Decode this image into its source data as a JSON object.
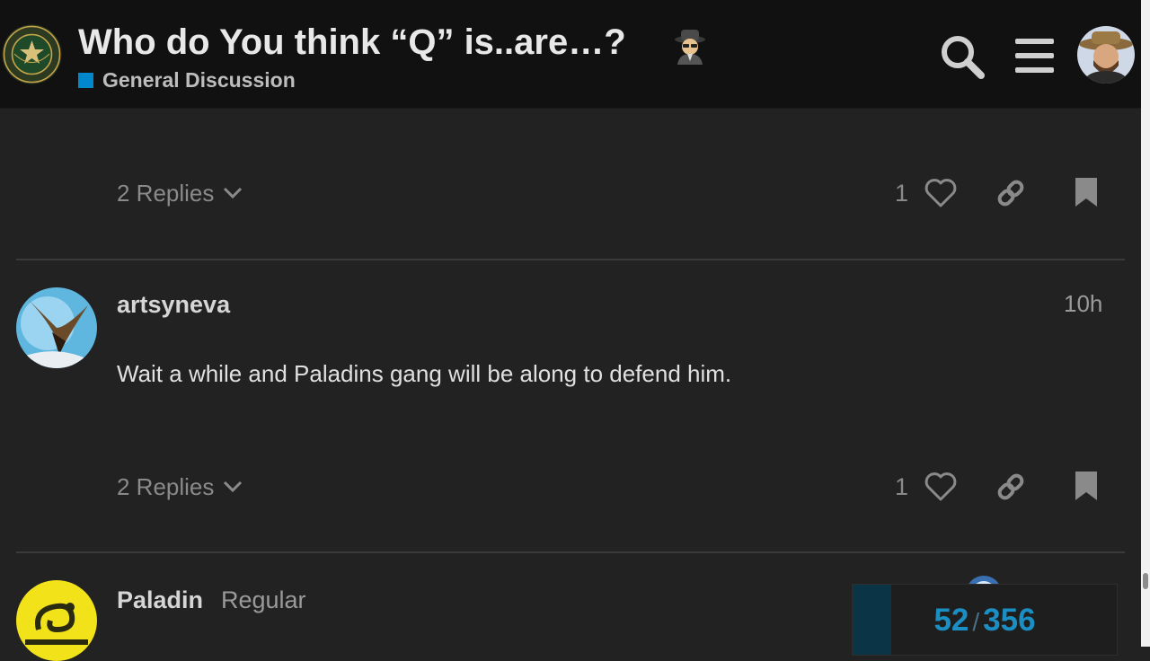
{
  "header": {
    "title": "Who do You think “Q” is..are…?",
    "title_emoji_name": "detective-emoji",
    "category": "General Discussion",
    "category_color": "#0088cc",
    "logo_name": "infowars-army-logo"
  },
  "posts": [
    {
      "replies_label": "2 Replies",
      "likes": "1"
    },
    {
      "username": "artsyneva",
      "date": "10h",
      "body": "Wait a while and Paladins gang will be along to defend him.",
      "replies_label": "2 Replies",
      "likes": "1"
    },
    {
      "username": "Paladin",
      "user_title": "Regular"
    }
  ],
  "progress": {
    "current": "52",
    "separator": "/",
    "total": "356",
    "fraction": 0.146
  },
  "colors": {
    "accent": "#0088cc",
    "progress_text": "#1b8fc4",
    "header_bg": "#111111",
    "page_bg": "#222222"
  }
}
